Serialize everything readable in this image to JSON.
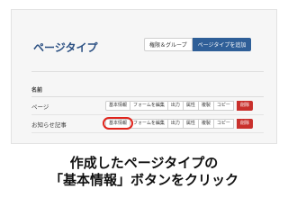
{
  "header": {
    "title": "ページタイプ",
    "buttons": [
      {
        "label": "権限＆グループ"
      },
      {
        "label": "ページタイプを追加"
      }
    ]
  },
  "table": {
    "column_name": "名前",
    "rows": [
      {
        "name": "ページ",
        "actions": [
          "基本情報",
          "フォームを編集",
          "出力",
          "属性",
          "複製",
          "コピー",
          "削除"
        ]
      },
      {
        "name": "お知らせ記事",
        "actions": [
          "基本情報",
          "フォームを編集",
          "出力",
          "属性",
          "複製",
          "コピー",
          "削除"
        ]
      }
    ]
  },
  "caption": {
    "line1": "作成したページタイプの",
    "line2": "「基本情報」ボタンをクリック"
  },
  "colors": {
    "title": "#2a4f82",
    "primary_button": "#2f5f98",
    "delete_button": "#c9302c",
    "highlight": "#e0241c"
  }
}
